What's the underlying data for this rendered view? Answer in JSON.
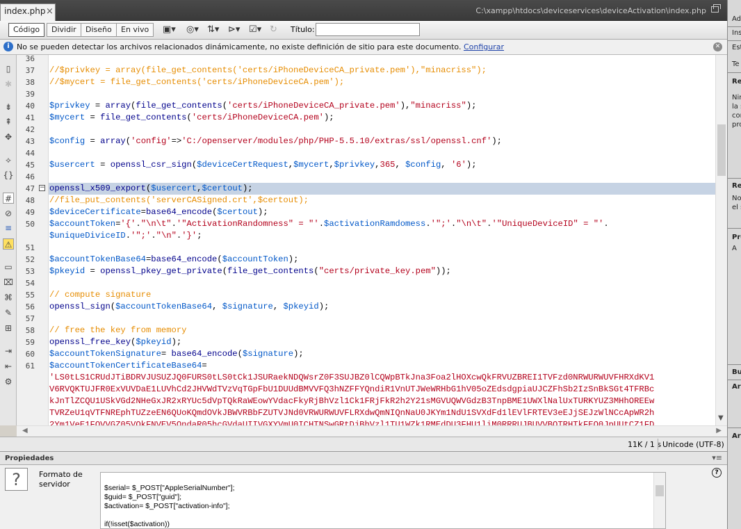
{
  "tab": {
    "label": "index.php",
    "close": "×"
  },
  "path": "C:\\xampp\\htdocs\\deviceservices\\deviceActivation\\index.php",
  "toolbar": {
    "views": [
      "Código",
      "Dividir",
      "Diseño",
      "En vivo"
    ],
    "title_label": "Título:",
    "title_value": ""
  },
  "info": {
    "message": "No se pueden detectar los archivos relacionados dinámicamente, no existe definición de sitio para este documento.",
    "link": "Configurar"
  },
  "gutter_lines": [
    "36",
    "37",
    "38",
    "39",
    "40",
    "41",
    "42",
    "43",
    "44",
    "45",
    "46",
    "47",
    "48",
    "49",
    "50",
    "",
    "51",
    "52",
    "53",
    "54",
    "55",
    "56",
    "57",
    "58",
    "59",
    "60",
    "61",
    "",
    "",
    "",
    "",
    ""
  ],
  "code_lines": [
    [],
    [
      [
        "c",
        "//$privkey = array(file_get_contents('certs/iPhoneDeviceCA_private.pem'),\"minacriss\");"
      ]
    ],
    [
      [
        "c",
        "//$mycert = file_get_contents('certs/iPhoneDeviceCA.pem');"
      ]
    ],
    [],
    [
      [
        "v",
        "$privkey"
      ],
      [
        "p",
        " = "
      ],
      [
        "f",
        "array"
      ],
      [
        "p",
        "("
      ],
      [
        "f",
        "file_get_contents"
      ],
      [
        "p",
        "("
      ],
      [
        "s",
        "'certs/iPhoneDeviceCA_private.pem'"
      ],
      [
        "p",
        "),"
      ],
      [
        "s",
        "\"minacriss\""
      ],
      [
        "p",
        ");"
      ]
    ],
    [
      [
        "v",
        "$mycert"
      ],
      [
        "p",
        " = "
      ],
      [
        "f",
        "file_get_contents"
      ],
      [
        "p",
        "("
      ],
      [
        "s",
        "'certs/iPhoneDeviceCA.pem'"
      ],
      [
        "p",
        ");"
      ]
    ],
    [],
    [
      [
        "v",
        "$config"
      ],
      [
        "p",
        " = "
      ],
      [
        "f",
        "array"
      ],
      [
        "p",
        "("
      ],
      [
        "s",
        "'config'"
      ],
      [
        "p",
        "=>"
      ],
      [
        "s",
        "'C:/openserver/modules/php/PHP-5.5.10/extras/ssl/openssl.cnf'"
      ],
      [
        "p",
        ");"
      ]
    ],
    [],
    [
      [
        "v",
        "$usercert"
      ],
      [
        "p",
        " = "
      ],
      [
        "f",
        "openssl_csr_sign"
      ],
      [
        "p",
        "("
      ],
      [
        "v",
        "$deviceCertRequest"
      ],
      [
        "p",
        ","
      ],
      [
        "v",
        "$mycert"
      ],
      [
        "p",
        ","
      ],
      [
        "v",
        "$privkey"
      ],
      [
        "p",
        ","
      ],
      [
        "n",
        "365"
      ],
      [
        "p",
        ", "
      ],
      [
        "v",
        "$config"
      ],
      [
        "p",
        ", "
      ],
      [
        "s",
        "'6'"
      ],
      [
        "p",
        ");"
      ]
    ],
    [],
    [
      [
        "f",
        "openssl_x509_export"
      ],
      [
        "p",
        "("
      ],
      [
        "v",
        "$usercert"
      ],
      [
        "p",
        ","
      ],
      [
        "v",
        "$certout"
      ],
      [
        "p",
        ");"
      ]
    ],
    [
      [
        "c",
        "//file_put_contents('serverCASigned.crt',$certout);"
      ]
    ],
    [
      [
        "v",
        "$deviceCertificate"
      ],
      [
        "p",
        "="
      ],
      [
        "f",
        "base64_encode"
      ],
      [
        "p",
        "("
      ],
      [
        "v",
        "$certout"
      ],
      [
        "p",
        ");"
      ]
    ],
    [
      [
        "v",
        "$accountToken"
      ],
      [
        "p",
        "="
      ],
      [
        "s",
        "'{'"
      ],
      [
        "p",
        "."
      ],
      [
        "s",
        "\"\\n\\t\""
      ],
      [
        "p",
        "."
      ],
      [
        "s",
        "'\"ActivationRandomness\" = \"'"
      ],
      [
        "p",
        "."
      ],
      [
        "v",
        "$activationRamdomess"
      ],
      [
        "p",
        "."
      ],
      [
        "s",
        "'\";'"
      ],
      [
        "p",
        "."
      ],
      [
        "s",
        "\"\\n\\t\""
      ],
      [
        "p",
        "."
      ],
      [
        "s",
        "'\"UniqueDeviceID\" = \"'"
      ],
      [
        "p",
        "."
      ]
    ],
    [
      [
        "v",
        "$uniqueDiviceID"
      ],
      [
        "p",
        "."
      ],
      [
        "s",
        "'\";'"
      ],
      [
        "p",
        "."
      ],
      [
        "s",
        "\"\\n\""
      ],
      [
        "p",
        "."
      ],
      [
        "s",
        "'}'"
      ],
      [
        "p",
        ";"
      ]
    ],
    [],
    [
      [
        "v",
        "$accountTokenBase64"
      ],
      [
        "p",
        "="
      ],
      [
        "f",
        "base64_encode"
      ],
      [
        "p",
        "("
      ],
      [
        "v",
        "$accountToken"
      ],
      [
        "p",
        ");"
      ]
    ],
    [
      [
        "v",
        "$pkeyid"
      ],
      [
        "p",
        " = "
      ],
      [
        "f",
        "openssl_pkey_get_private"
      ],
      [
        "p",
        "("
      ],
      [
        "f",
        "file_get_contents"
      ],
      [
        "p",
        "("
      ],
      [
        "s",
        "\"certs/private_key.pem\""
      ],
      [
        "p",
        "));"
      ]
    ],
    [],
    [
      [
        "c",
        "// compute signature"
      ]
    ],
    [
      [
        "f",
        "openssl_sign"
      ],
      [
        "p",
        "("
      ],
      [
        "v",
        "$accountTokenBase64"
      ],
      [
        "p",
        ", "
      ],
      [
        "v",
        "$signature"
      ],
      [
        "p",
        ", "
      ],
      [
        "v",
        "$pkeyid"
      ],
      [
        "p",
        ");"
      ]
    ],
    [],
    [
      [
        "c",
        "// free the key from memory"
      ]
    ],
    [
      [
        "f",
        "openssl_free_key"
      ],
      [
        "p",
        "("
      ],
      [
        "v",
        "$pkeyid"
      ],
      [
        "p",
        ");"
      ]
    ],
    [
      [
        "v",
        "$accountTokenSignature"
      ],
      [
        "p",
        "= "
      ],
      [
        "f",
        "base64_encode"
      ],
      [
        "p",
        "("
      ],
      [
        "v",
        "$signature"
      ],
      [
        "p",
        ");"
      ]
    ],
    [
      [
        "v",
        "$accountTokenCertificateBase64"
      ],
      [
        "p",
        "="
      ]
    ],
    [
      [
        "s",
        "'LS0tLS1CRUdJTiBDRVJUSUZJQ0FURS0tLS0tCk1JSURaekNDQWsrZ0F3SUJBZ0lCQWpBTkJna3Foa2lHOXcwQkFRVUZBREI1TVFzd0NRWURWUVFHRXdKV1"
      ]
    ],
    [
      [
        "s",
        "V6RVQKTUJFR0ExVUVDaE1LUVhCd2JHVWdTVzVqTGpFbU1DUUdBMVVFQ3hNZFFYQndiR1VnUTJWeWRHbG1hV05oZEdsdgpiaUJCZFhSb2IzSnBkSGt4TFRBc"
      ]
    ],
    [
      [
        "s",
        "kJnTlZCQU1USkVGd2NHeGxJR2xRYUc5dVpTQkRaWEowYVdacFkyRjBhVzl1Ck1FRjFkR2h2Y21sMGVUQWVGdzB3TnpBME1UWXlNalUxTURKYUZ3MHhOREEw"
      ]
    ],
    [
      [
        "s",
        "TVRZeU1qVTFNREphTUZzeEN6QUoKQmdOVkJBWVRBbFZUTVJNd0VRWURWUVFLRXdwQmNIQnNaU0JKYm1NdU1SVXdFd1lEVlFRTEV3eEJjSEJzWlNCcApWR2h"
      ]
    ],
    [
      [
        "s",
        "2Ym1VeE1FQVVGZ05VQkFNVEV5QndaR05hcGVdaUIIVGXYVmU0ICHTNSwGRtDjBhVzl1TU1WZk1RMEdDU3FHU1liM0RRRUJBUVVBQTRHTkFEQ0JpUUtCZ1FD"
      ]
    ]
  ],
  "status": {
    "size": "11K / 1 s",
    "encoding": "Unicode (UTF-8)"
  },
  "properties": {
    "title": "Propiedades",
    "format_label": "Formato de servidor",
    "code": [
      "",
      "$serial= $_POST[\"AppleSerialNumber\"];",
      "$guid= $_POST[\"guid\"];",
      "$activation= $_POST[\"activation-info\"];",
      "",
      "if(!isset($activation))"
    ]
  },
  "right_panel": {
    "items": [
      "Adm",
      "Ins",
      "Est",
      "Te",
      "Res",
      "Nin",
      "la s",
      "cor",
      "pro",
      "Reg",
      "No",
      "el s",
      "Pro",
      "A",
      "Bus",
      "Arc",
      "Arc"
    ]
  }
}
